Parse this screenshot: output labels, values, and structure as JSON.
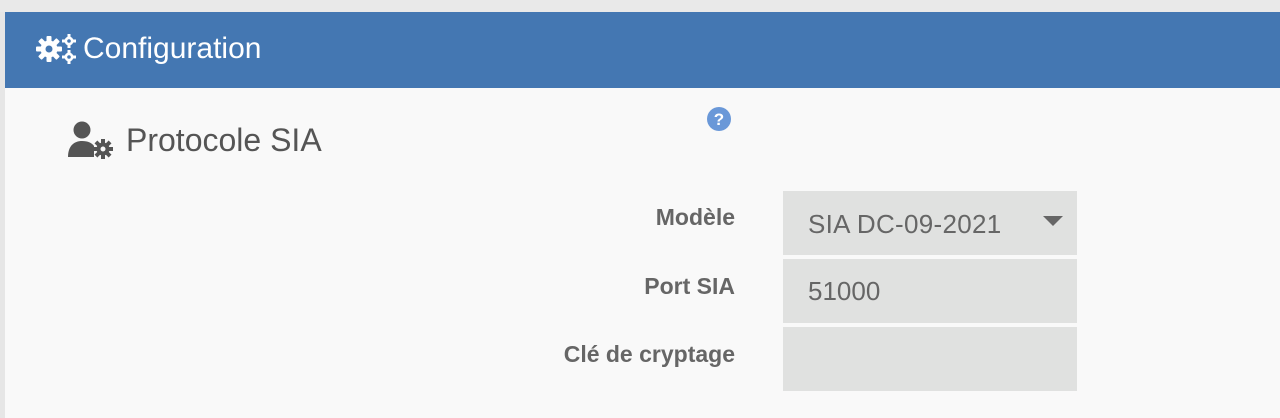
{
  "header": {
    "title": "Configuration",
    "icon": "gears-icon",
    "background_color": "#4477b2"
  },
  "section": {
    "title": "Protocole SIA",
    "icon": "user-gear-icon"
  },
  "form": {
    "model": {
      "label": "Modèle",
      "help_icon": "question-circle-icon",
      "selected_value": "SIA DC-09-2021"
    },
    "port": {
      "label": "Port SIA",
      "value": "51000"
    },
    "encryption_key": {
      "label": "Clé de cryptage",
      "value": ""
    }
  },
  "colors": {
    "field_background": "#e0e1e0",
    "help_icon": "#6a98d8",
    "text": "#666666"
  }
}
